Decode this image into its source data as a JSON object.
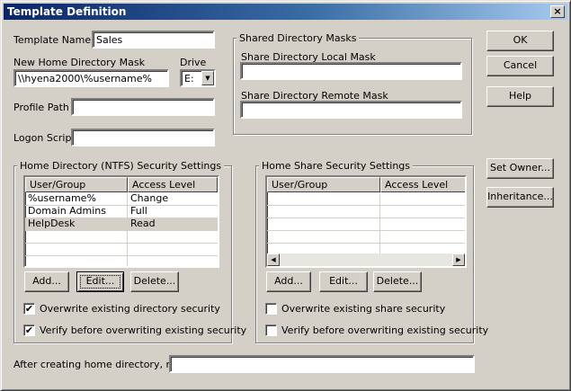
{
  "window": {
    "title": "Template Definition",
    "close_glyph": "×"
  },
  "template_name": {
    "label": "Template Name",
    "value": "Sales"
  },
  "home_dir_mask": {
    "label": "New Home Directory Mask",
    "value": "\\\\hyena2000\\%username%"
  },
  "drive": {
    "label": "Drive",
    "value": "E:"
  },
  "profile_path": {
    "label": "Profile Path",
    "value": ""
  },
  "logon_script": {
    "label": "Logon Script",
    "value": ""
  },
  "shared_dir_masks": {
    "title": "Shared Directory Masks",
    "local_label": "Share Directory Local Mask",
    "local_value": "",
    "remote_label": "Share Directory Remote Mask",
    "remote_value": ""
  },
  "buttons": {
    "ok": "OK",
    "cancel": "Cancel",
    "help": "Help",
    "set_owner": "Set Owner...",
    "inheritance": "Inheritance..."
  },
  "ntfs_security": {
    "title": "Home Directory (NTFS) Security Settings",
    "columns": [
      "User/Group",
      "Access Level"
    ],
    "rows": [
      {
        "user": "%username%",
        "access": "Change"
      },
      {
        "user": "Domain Admins",
        "access": "Full"
      },
      {
        "user": "HelpDesk",
        "access": "Read"
      }
    ],
    "add": "Add...",
    "edit": "Edit...",
    "delete": "Delete...",
    "overwrite_label": "Overwrite existing directory security",
    "overwrite_checked": true,
    "verify_label": "Verify before overwriting existing security",
    "verify_checked": true
  },
  "share_security": {
    "title": "Home Share Security Settings",
    "columns": [
      "User/Group",
      "Access Level"
    ],
    "rows": [],
    "add": "Add...",
    "edit": "Edit...",
    "delete": "Delete...",
    "overwrite_label": "Overwrite existing share security",
    "overwrite_checked": false,
    "verify_label": "Verify before overwriting existing security",
    "verify_checked": false
  },
  "after_create": {
    "label": "After creating home directory, run:",
    "value": ""
  },
  "icons": {
    "check": "✔",
    "combo_arrow": "▼",
    "scroll_left": "◀",
    "scroll_right": "▶"
  },
  "colors": {
    "titlebar_start": "#0a246a",
    "titlebar_end": "#a6caf0",
    "face": "#d4d0c8",
    "selected_row": "#d4d0c8"
  }
}
